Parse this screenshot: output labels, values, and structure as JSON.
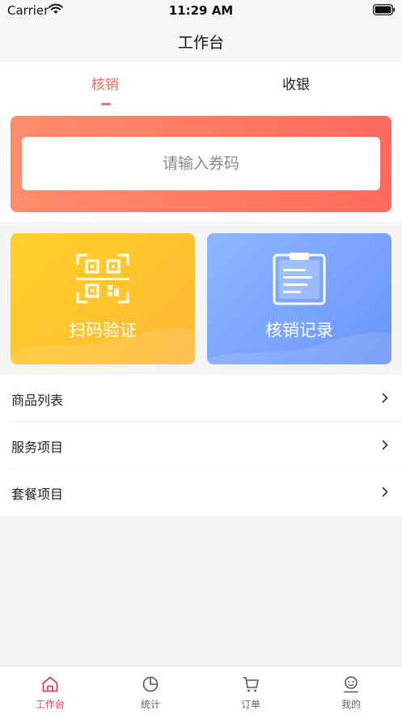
{
  "status_bar": {
    "carrier": "Carrier",
    "time": "11:29 AM",
    "wifi_icon": "wifi-icon",
    "battery_icon": "battery-icon"
  },
  "nav": {
    "title": "工作台"
  },
  "tabs": [
    {
      "label": "核销",
      "active": true
    },
    {
      "label": "收银",
      "active": false
    }
  ],
  "coupon": {
    "placeholder": "请输入券码"
  },
  "actions": [
    {
      "label": "扫码验证",
      "icon": "qr-scan-icon"
    },
    {
      "label": "核销记录",
      "icon": "clipboard-icon"
    }
  ],
  "menu": [
    {
      "label": "商品列表"
    },
    {
      "label": "服务项目"
    },
    {
      "label": "套餐项目"
    }
  ],
  "tab_bar": [
    {
      "label": "工作台",
      "icon": "home-icon",
      "active": true
    },
    {
      "label": "统计",
      "icon": "pie-chart-icon",
      "active": false
    },
    {
      "label": "订单",
      "icon": "cart-icon",
      "active": false
    },
    {
      "label": "我的",
      "icon": "profile-icon",
      "active": false
    }
  ],
  "colors": {
    "accent": "#f26b5b",
    "tab_active": "#e83e56",
    "scan_card": "#ffc22e",
    "records_card": "#7aa4ff"
  }
}
